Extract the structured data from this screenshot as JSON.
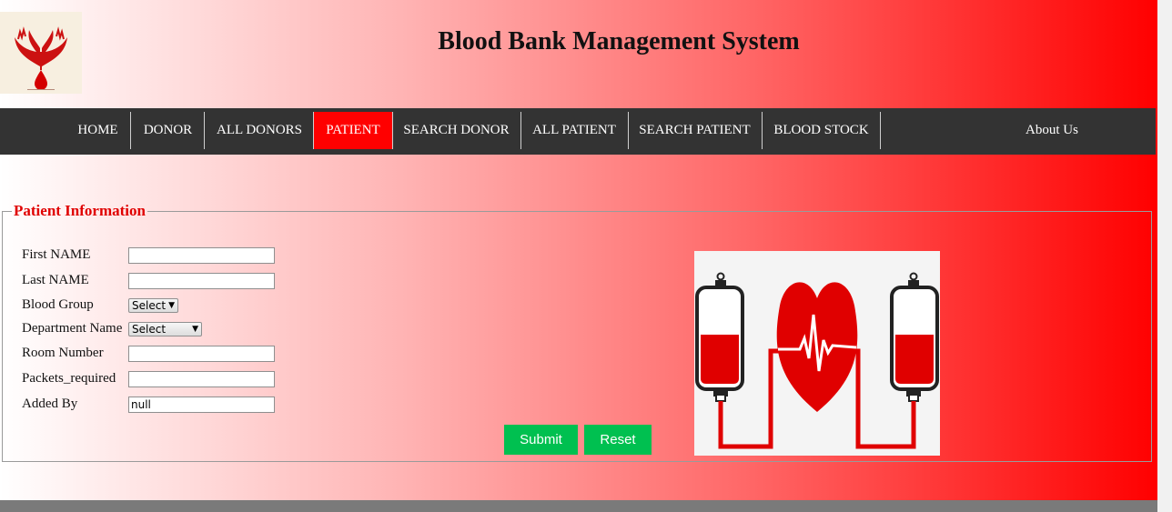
{
  "header": {
    "title": "Blood Bank Management System"
  },
  "nav": {
    "items": [
      {
        "label": "HOME",
        "active": false
      },
      {
        "label": "DONOR",
        "active": false
      },
      {
        "label": "ALL DONORS",
        "active": false
      },
      {
        "label": "PATIENT",
        "active": true
      },
      {
        "label": "SEARCH DONOR",
        "active": false
      },
      {
        "label": "ALL PATIENT",
        "active": false
      },
      {
        "label": "SEARCH PATIENT",
        "active": false
      },
      {
        "label": "BLOOD STOCK",
        "active": false
      }
    ],
    "about": "About Us"
  },
  "form": {
    "legend": "Patient Information",
    "fields": {
      "first_name": {
        "label": "First NAME",
        "value": ""
      },
      "last_name": {
        "label": "Last NAME",
        "value": ""
      },
      "blood_group": {
        "label": "Blood Group",
        "selected": "Select"
      },
      "department": {
        "label": "Department Name",
        "selected": "Select"
      },
      "room_number": {
        "label": "Room Number",
        "value": ""
      },
      "packets_required": {
        "label": "Packets_required",
        "value": ""
      },
      "added_by": {
        "label": "Added By",
        "value": "null"
      }
    },
    "submit_label": "Submit",
    "reset_label": "Reset"
  },
  "colors": {
    "brand_red": "#ff0000",
    "navbar": "#333333",
    "button_green": "#00c050",
    "legend_text": "#e00000"
  },
  "icons": {
    "logo": "hands-blood-drop-logo",
    "illustration": "blood-transfusion-heart-icon"
  }
}
